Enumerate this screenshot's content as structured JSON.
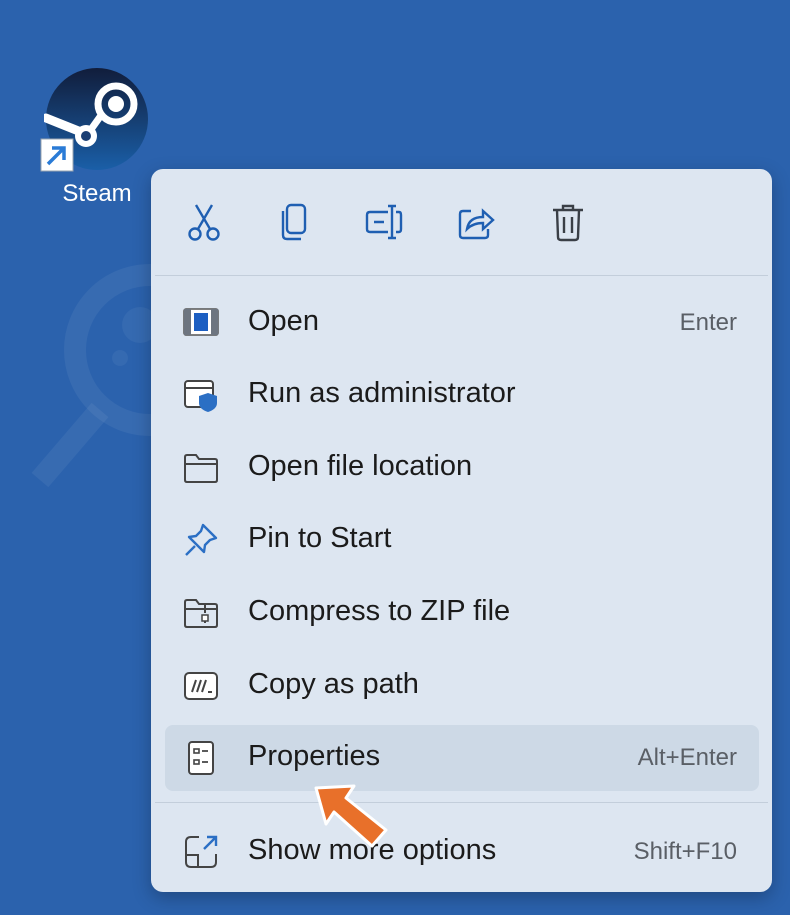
{
  "desktop": {
    "background": "#2b62ad",
    "icon": {
      "name": "steam-icon",
      "label": "Steam"
    }
  },
  "toolbar": [
    {
      "name": "cut-icon"
    },
    {
      "name": "copy-icon"
    },
    {
      "name": "rename-icon"
    },
    {
      "name": "share-icon"
    },
    {
      "name": "delete-icon"
    }
  ],
  "menu": {
    "items": [
      {
        "label": "Open",
        "shortcut": "Enter",
        "icon": "open-app-icon"
      },
      {
        "label": "Run as administrator",
        "shortcut": "",
        "icon": "admin-shield-icon"
      },
      {
        "label": "Open file location",
        "shortcut": "",
        "icon": "folder-icon"
      },
      {
        "label": "Pin to Start",
        "shortcut": "",
        "icon": "pin-icon"
      },
      {
        "label": "Compress to ZIP file",
        "shortcut": "",
        "icon": "zip-folder-icon"
      },
      {
        "label": "Copy as path",
        "shortcut": "",
        "icon": "copy-path-icon"
      },
      {
        "label": "Properties",
        "shortcut": "Alt+Enter",
        "icon": "properties-icon",
        "highlighted": true
      },
      {
        "label": "Show more options",
        "shortcut": "Shift+F10",
        "icon": "more-options-icon"
      }
    ]
  },
  "colors": {
    "menu_bg": "#dde6f1",
    "highlight": "#cdd9e6",
    "accent_icon": "#2b6fc4",
    "pointer": "#e8702a"
  }
}
